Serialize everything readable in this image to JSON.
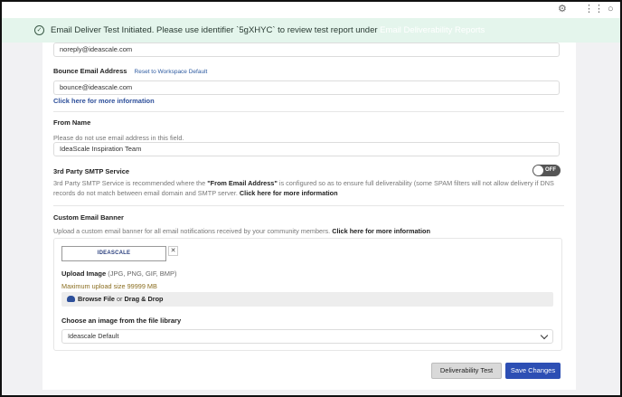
{
  "toast": {
    "message": "Email Deliver Test Initiated. Please use identifier `5gXHYC` to review test report under",
    "link_text": "Email Deliverability Reports"
  },
  "fields": {
    "from_email_value": "noreply@ideascale.com",
    "bounce_label": "Bounce Email Address",
    "bounce_reset": "Reset to Workspace Default",
    "bounce_value": "bounce@ideascale.com",
    "bounce_more_info": "Click here for more information",
    "from_name_label": "From Name",
    "from_name_help": "Please do not use email address in this field.",
    "from_name_value": "IdeaScale Inspiration Team"
  },
  "smtp": {
    "label": "3rd Party SMTP Service",
    "desc_prefix": "3rd Party SMTP Service is recommended where the",
    "desc_bold": "\"From Email Address\"",
    "desc_suffix": "is configured so as to ensure full deliverability (some SPAM filters will not allow delivery if DNS records do not match between email domain and SMTP server.",
    "desc_link": "Click here for more information",
    "toggle_state": "OFF"
  },
  "banner": {
    "label": "Custom Email Banner",
    "desc": "Upload a custom email banner for all email notifications received by your community members.",
    "desc_link": "Click here for more information",
    "preview_text": "IDEASCALE",
    "upload_label": "Upload Image",
    "upload_formats": "(JPG, PNG, GIF, BMP)",
    "max_size": "Maximum upload size 99999 MB",
    "browse_file": "Browse File",
    "browse_or": "or",
    "drag_drop": "Drag & Drop",
    "library_label": "Choose an image from the file library",
    "library_selected": "Ideascale Default"
  },
  "buttons": {
    "deliverability_test": "Deliverability Test",
    "save_changes": "Save Changes"
  },
  "icons": {
    "top": [
      "puzzle-icon",
      "grid-icon",
      "chat-icon"
    ],
    "toast": "check-circle-icon",
    "upload": "cloud-upload-icon",
    "close": "close-icon",
    "select": "chevron-down-icon"
  }
}
